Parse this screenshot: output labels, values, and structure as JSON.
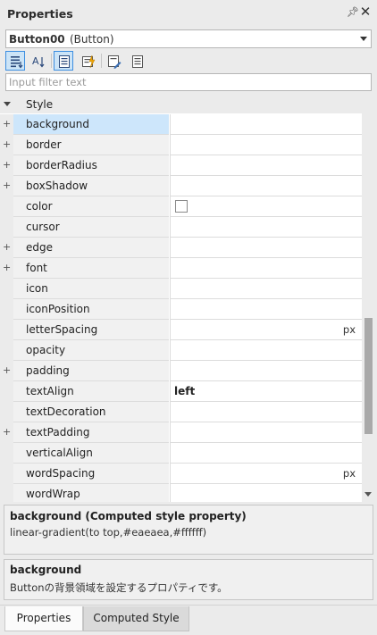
{
  "panel": {
    "title": "Properties"
  },
  "object_selector": {
    "name": "Button00",
    "type": "(Button)"
  },
  "toolbar": {
    "buttons": [
      {
        "icon": "categorized-icon",
        "active": true
      },
      {
        "icon": "alphabetical-icon",
        "active": false
      },
      {
        "icon": "properties-view-icon",
        "active": true
      },
      {
        "icon": "events-icon",
        "active": false
      },
      {
        "icon": "edit-style-icon",
        "active": false
      },
      {
        "icon": "document-icon",
        "active": false
      }
    ]
  },
  "filter": {
    "placeholder": "Input filter text",
    "value": ""
  },
  "category": {
    "label": "Style"
  },
  "properties": [
    {
      "name": "background",
      "expandable": true,
      "selected": true,
      "value": "",
      "unit": ""
    },
    {
      "name": "border",
      "expandable": true,
      "value": "",
      "unit": ""
    },
    {
      "name": "borderRadius",
      "expandable": true,
      "value": "",
      "unit": ""
    },
    {
      "name": "boxShadow",
      "expandable": true,
      "value": "",
      "unit": ""
    },
    {
      "name": "color",
      "expandable": false,
      "value": "",
      "unit": "",
      "checkbox": true
    },
    {
      "name": "cursor",
      "expandable": false,
      "value": "",
      "unit": ""
    },
    {
      "name": "edge",
      "expandable": true,
      "value": "",
      "unit": ""
    },
    {
      "name": "font",
      "expandable": true,
      "value": "",
      "unit": ""
    },
    {
      "name": "icon",
      "expandable": false,
      "value": "",
      "unit": ""
    },
    {
      "name": "iconPosition",
      "expandable": false,
      "value": "",
      "unit": ""
    },
    {
      "name": "letterSpacing",
      "expandable": false,
      "value": "",
      "unit": "px"
    },
    {
      "name": "opacity",
      "expandable": false,
      "value": "",
      "unit": ""
    },
    {
      "name": "padding",
      "expandable": true,
      "value": "",
      "unit": ""
    },
    {
      "name": "textAlign",
      "expandable": false,
      "value": "left",
      "unit": ""
    },
    {
      "name": "textDecoration",
      "expandable": false,
      "value": "",
      "unit": ""
    },
    {
      "name": "textPadding",
      "expandable": true,
      "value": "",
      "unit": ""
    },
    {
      "name": "verticalAlign",
      "expandable": false,
      "value": "",
      "unit": ""
    },
    {
      "name": "wordSpacing",
      "expandable": false,
      "value": "",
      "unit": "px"
    },
    {
      "name": "wordWrap",
      "expandable": false,
      "value": "",
      "unit": ""
    }
  ],
  "computed_info": {
    "heading": "background (Computed style property)",
    "value": "linear-gradient(to top,#eaeaea,#ffffff)"
  },
  "description": {
    "heading": "background",
    "text": "Buttonの背景領域を設定するプロパティです。"
  },
  "tabs": [
    {
      "label": "Properties",
      "active": true
    },
    {
      "label": "Computed Style",
      "active": false
    }
  ],
  "colors": {
    "selected_row": "#cde6fb",
    "toolbar_active": "#cce4f7",
    "accent_border": "#3d8ee0"
  }
}
